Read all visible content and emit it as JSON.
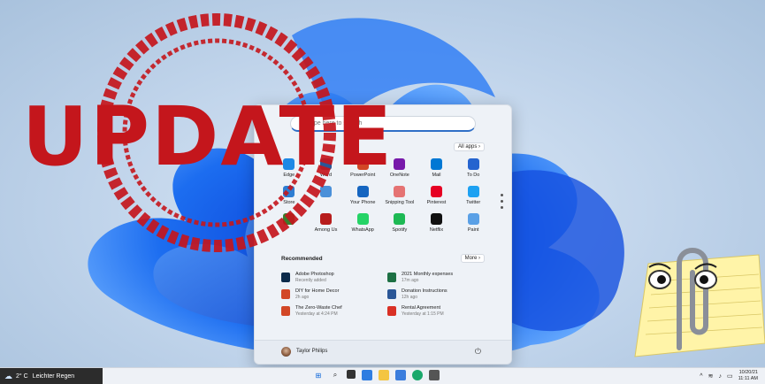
{
  "stamp": {
    "word": "UPDATE",
    "color": "#c4161c"
  },
  "start_menu": {
    "search_placeholder": "Type here to search",
    "all_apps_label": "All apps ›",
    "pinned": [
      {
        "label": "Edge",
        "color": "#1e88e5"
      },
      {
        "label": "Word",
        "color": "#2b5797"
      },
      {
        "label": "PowerPoint",
        "color": "#d24726"
      },
      {
        "label": "OneNote",
        "color": "#7719aa"
      },
      {
        "label": "Mail",
        "color": "#0078d4"
      },
      {
        "label": "To Do",
        "color": "#2564cf"
      },
      {
        "label": "Store",
        "color": "#2d7dd2"
      },
      {
        "label": "",
        "color": "#4a90d9"
      },
      {
        "label": "Your Phone",
        "color": "#1565c0"
      },
      {
        "label": "Snipping Tool",
        "color": "#e57373"
      },
      {
        "label": "Pinterest",
        "color": "#e60023"
      },
      {
        "label": "Twitter",
        "color": "#1da1f2"
      },
      {
        "label": "",
        "color": "#3a7d2c"
      },
      {
        "label": "Among Us",
        "color": "#b71c1c"
      },
      {
        "label": "WhatsApp",
        "color": "#25d366"
      },
      {
        "label": "Spotify",
        "color": "#1db954"
      },
      {
        "label": "Netflix",
        "color": "#111111"
      },
      {
        "label": "Paint",
        "color": "#5aa0e6"
      }
    ],
    "recommended_title": "Recommended",
    "more_label": "More ›",
    "recommended": [
      {
        "title": "Adobe Photoshop",
        "sub": "Recently added",
        "color": "#0b2a4a"
      },
      {
        "title": "2021 Monthly expenses",
        "sub": "17m ago",
        "color": "#1d7044"
      },
      {
        "title": "DIY for Home Decor",
        "sub": "2h ago",
        "color": "#d24726"
      },
      {
        "title": "Donation Instructions",
        "sub": "12h ago",
        "color": "#2b5797"
      },
      {
        "title": "The Zero-Waste Chef",
        "sub": "Yesterday at 4:24 PM",
        "color": "#d24726"
      },
      {
        "title": "Rental Agreement",
        "sub": "Yesterday at 1:15 PM",
        "color": "#d93025"
      }
    ],
    "user_name": "Taylor Philips"
  },
  "taskbar": {
    "temperature": "2° C",
    "weather_text": "Leichter Regen",
    "date": "10/20/21",
    "time": "11:11 AM"
  }
}
